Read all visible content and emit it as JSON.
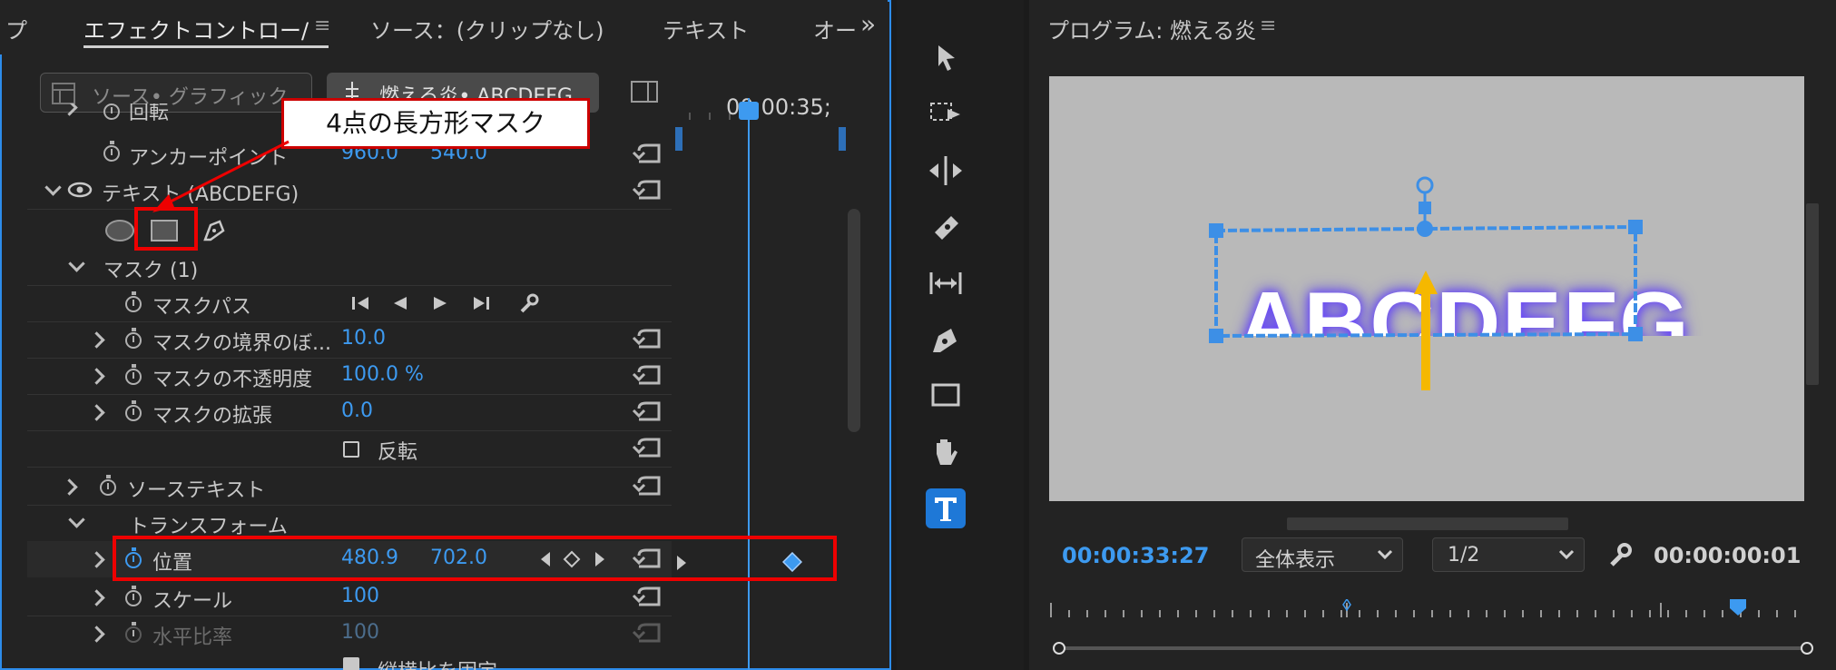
{
  "effect_controls": {
    "tabs": [
      "プ",
      "エフェクトコントロー/",
      "ソース：(クリップなし)",
      "テキスト",
      "オー"
    ],
    "menu_glyph": "≡",
    "more_glyph": "»",
    "source_graphic_label": "ソース• グラフィック",
    "clip_label": "燃える炎• ABCDEFG",
    "timecode": "00:00:35;",
    "rows": {
      "rotation": "回転",
      "anchor_point": "アンカーポイント",
      "anchor_x": "960.0",
      "anchor_y": "540.0",
      "text_layer": "テキスト (ABCDEFG)",
      "mask": "マスク (1)",
      "mask_path": "マスクパス",
      "mask_feather": "マスクの境界のぼ...",
      "mask_feather_val": "10.0",
      "mask_opacity": "マスクの不透明度",
      "mask_opacity_val": "100.0 %",
      "mask_expansion": "マスクの拡張",
      "mask_expansion_val": "0.0",
      "invert": "反転",
      "source_text": "ソーステキスト",
      "transform": "トランスフォーム",
      "position": "位置",
      "position_x": "480.9",
      "position_y": "702.0",
      "scale": "スケール",
      "scale_val": "100",
      "horizontal_ratio": "水平比率",
      "horizontal_ratio_val": "100",
      "uniform_scale": "縦横比を固定"
    },
    "callout": "4点の長方形マスク"
  },
  "program_monitor": {
    "title": "プログラム: 燃える炎",
    "menu_glyph": "≡",
    "frame_text": "ABCDEFG",
    "current_timecode": "00:00:33:27",
    "zoom_select": "全体表示",
    "resolution_select": "1/2",
    "duration": "00:00:00:01"
  },
  "colors": {
    "accent": "#3d9af0",
    "highlight_red": "#e00000",
    "arrow_yellow": "#f5b800"
  }
}
